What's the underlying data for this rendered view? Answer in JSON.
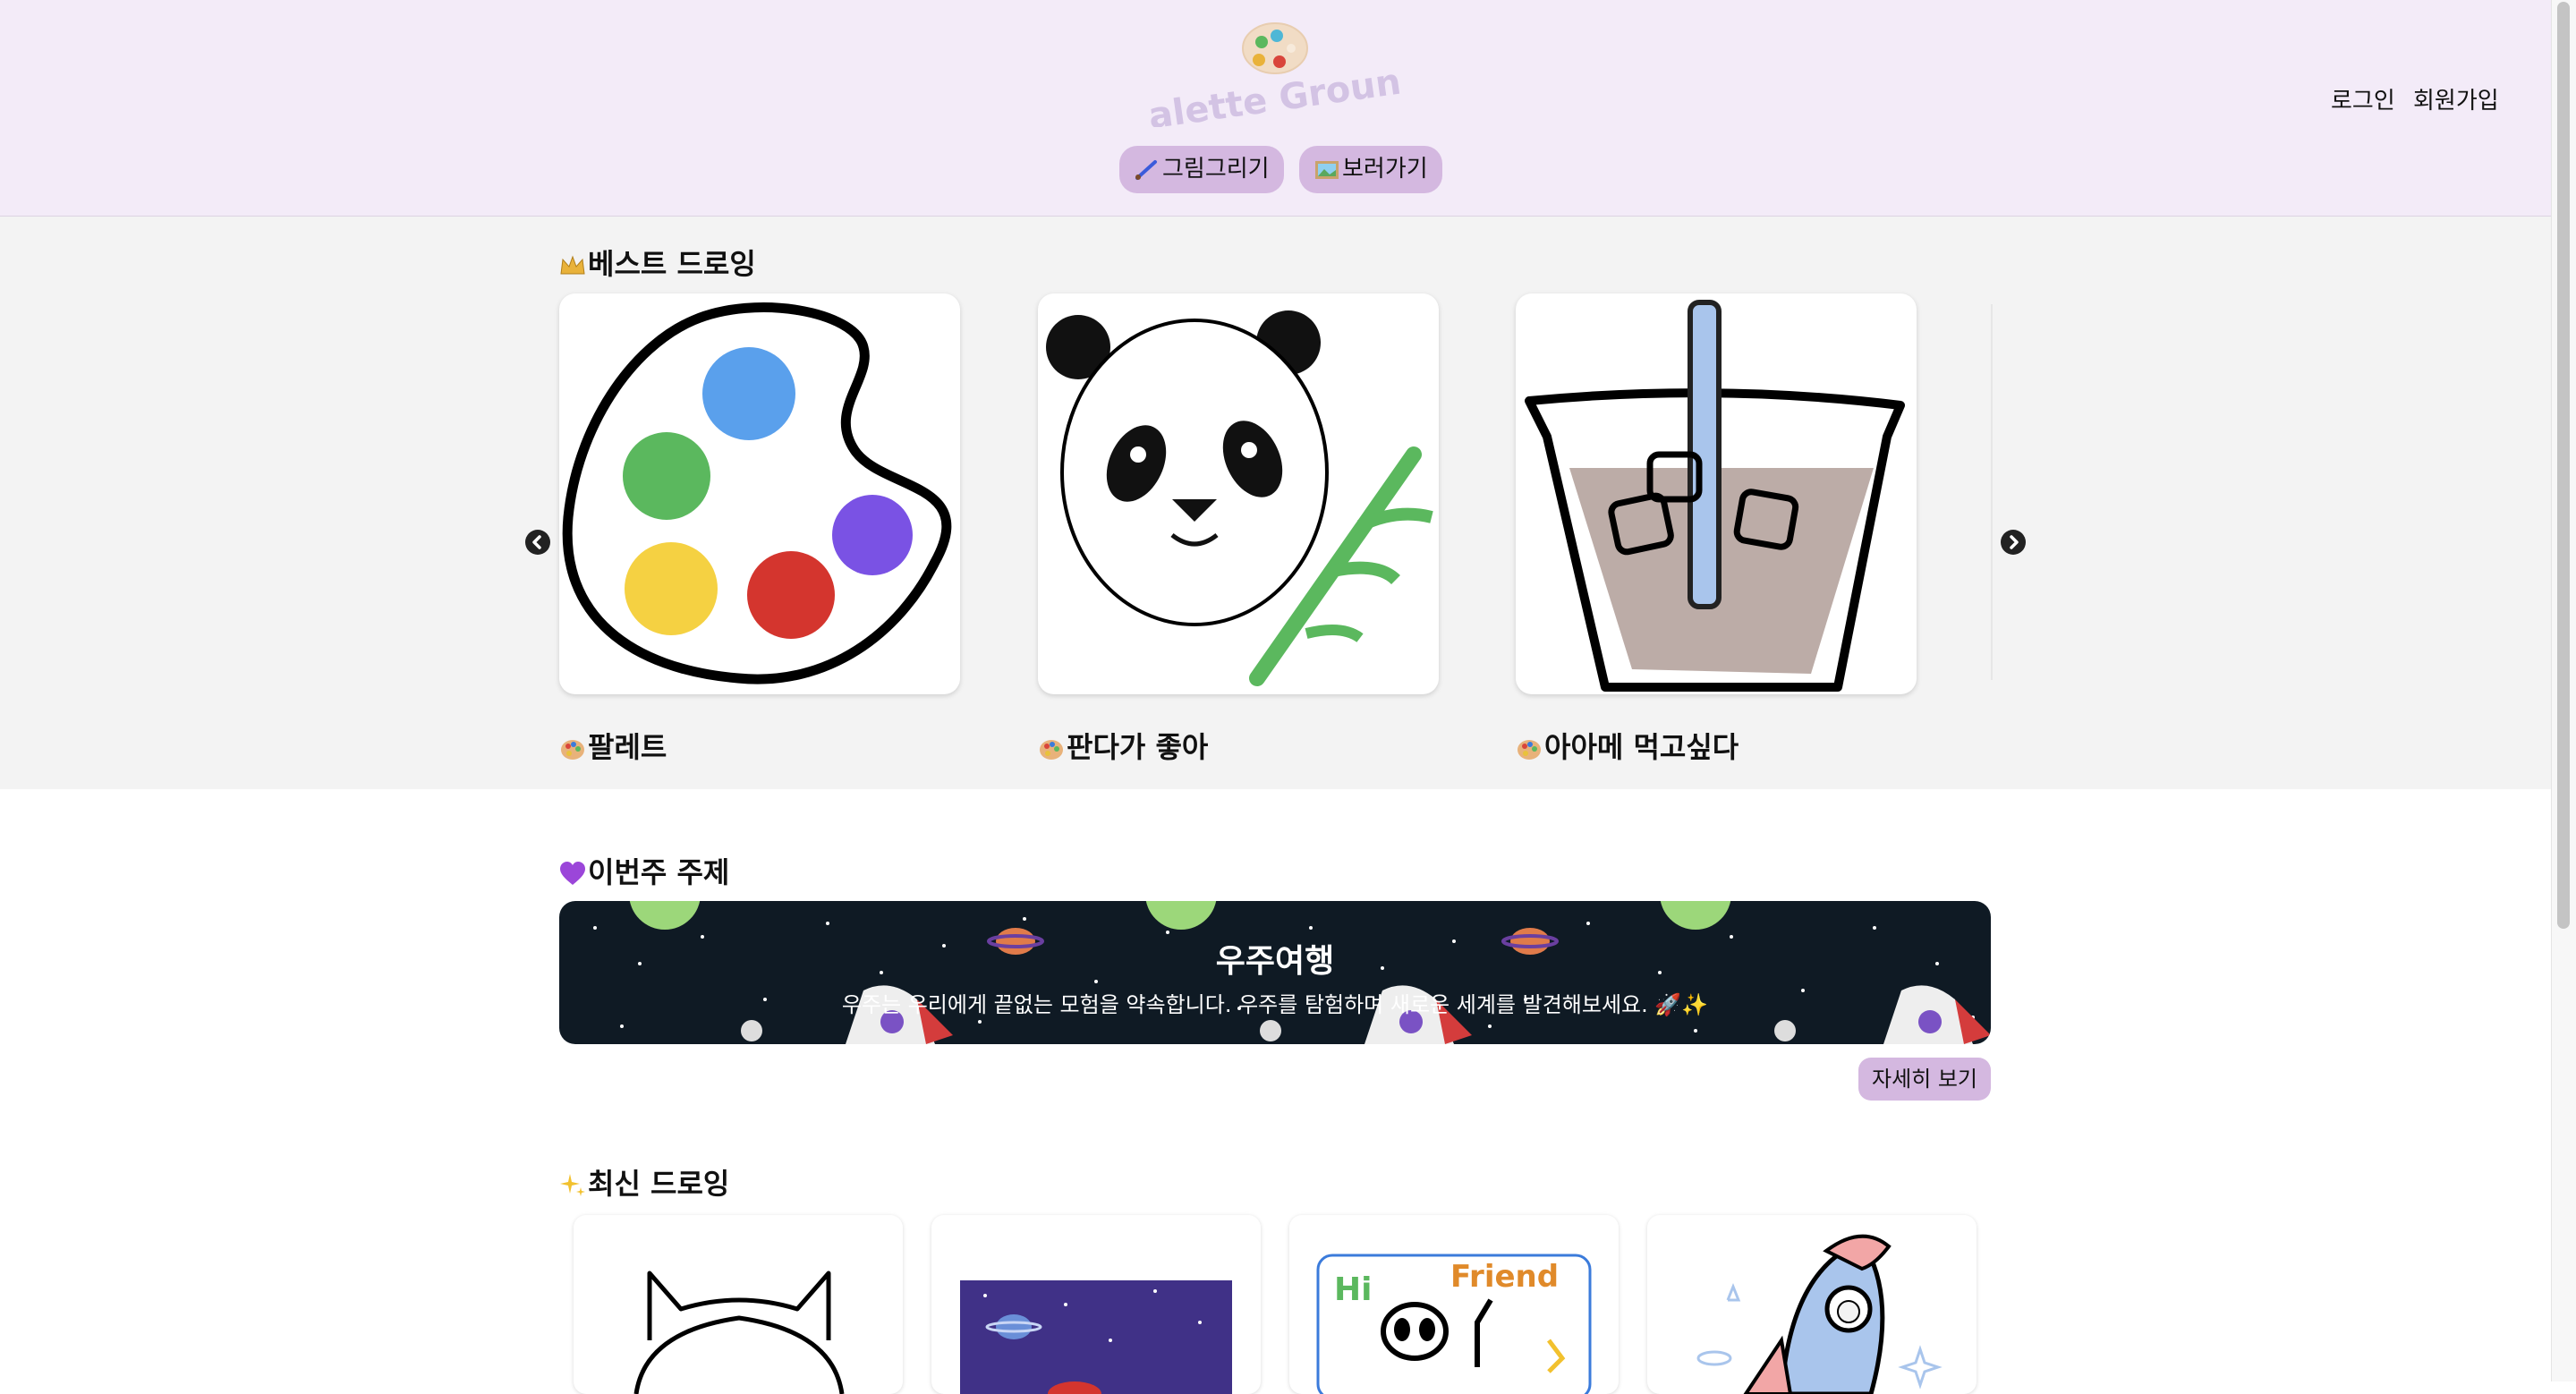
{
  "header": {
    "logo_text": "Palette Ground",
    "nav": [
      {
        "label": "그림그리기",
        "icon": "paintbrush-icon"
      },
      {
        "label": "보러가기",
        "icon": "framed-picture-icon"
      }
    ],
    "login_label": "로그인",
    "signup_label": "회원가입"
  },
  "best": {
    "title": "베스트 드로잉",
    "title_icon": "crown-icon",
    "cards": [
      {
        "title": "팔레트",
        "icon": "palette-icon"
      },
      {
        "title": "판다가 좋아",
        "icon": "palette-icon"
      },
      {
        "title": "아아메 먹고싶다",
        "icon": "palette-icon"
      }
    ],
    "prev_icon": "chevron-left-icon",
    "next_icon": "chevron-right-icon"
  },
  "theme": {
    "title": "이번주 주제",
    "title_icon": "purple-heart-icon",
    "banner_title": "우주여행",
    "banner_desc": "우주는 우리에게 끝없는 모험을 약속합니다. 우주를 탐험하며 새로운 세계를 발견해보세요. 🚀✨",
    "detail_label": "자세히 보기"
  },
  "recent": {
    "title": "최신 드로잉",
    "title_icon": "sparkles-icon"
  },
  "colors": {
    "header_bg": "#f3ebf8",
    "accent": "#d4b8e0",
    "banner_bg": "#0f1a24"
  }
}
